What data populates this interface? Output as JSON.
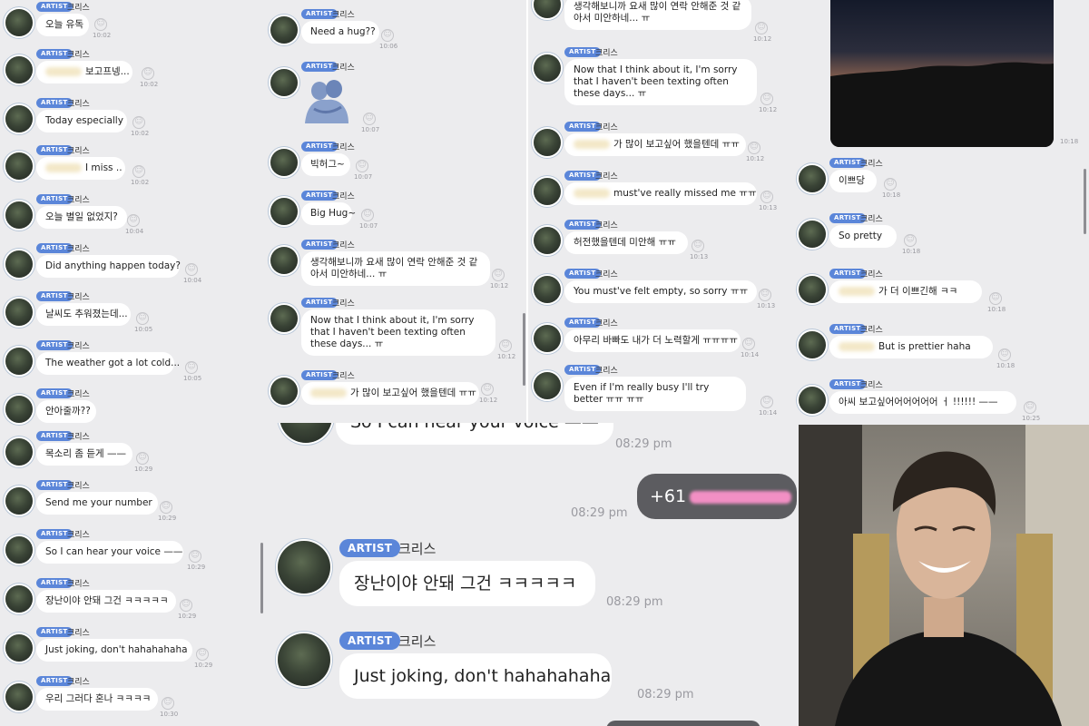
{
  "artist_badge": "ARTIST",
  "artist_name": "크리스",
  "panel1": {
    "messages": [
      {
        "text": "오늘 유독",
        "time": "10:02"
      },
      {
        "text": "보고프넹...",
        "time": "10:02",
        "blurred": true
      },
      {
        "text": "Today especially",
        "time": "10:02"
      },
      {
        "text": "I miss ..",
        "time": "10:02",
        "blurred": true
      },
      {
        "text": "오늘 별일 없었지?",
        "time": "10:04"
      },
      {
        "text": "Did anything happen today?",
        "time": "10:04"
      },
      {
        "text": "날씨도 추워졌는데...",
        "time": "10:05"
      },
      {
        "text": "The weather got a lot cold...",
        "time": "10:05"
      },
      {
        "text": "안아줄까??",
        "time": ""
      },
      {
        "text": "목소리 좀 듣게 ——",
        "time": "10:29"
      },
      {
        "text": "Send me your number",
        "time": "10:29"
      },
      {
        "text": "So I can hear your voice ——",
        "time": "10:29"
      },
      {
        "text": "장난이야 안돼 그건 ㅋㅋㅋㅋㅋ",
        "time": "10:29"
      },
      {
        "text": "Just joking, don't hahahahaha",
        "time": "10:29"
      },
      {
        "text": "우리 그러다 혼나 ㅋㅋㅋㅋ",
        "time": "10:30"
      }
    ]
  },
  "panel2": {
    "messages": [
      {
        "text": "Need a hug??",
        "time": "10:06"
      },
      {
        "text": "",
        "time": "10:07",
        "sticker": true
      },
      {
        "text": "빅허그~",
        "time": "10:07"
      },
      {
        "text": "Big Hug~",
        "time": "10:07"
      },
      {
        "text": "생각해보니까 요새 많이 연락 안해준 것 같아서 미안하네... ㅠ",
        "time": "10:12"
      },
      {
        "text": "Now that I think about it, I'm sorry that I haven't been texting often these days... ㅠ",
        "time": "10:12"
      },
      {
        "text": "가 많이 보고싶어 했을텐데 ㅠㅠ",
        "time": "10:12",
        "blurred": true
      }
    ]
  },
  "panel3": {
    "messages": [
      {
        "text": "생각해보니까 요새 많이 연락 안해준 것 같아서 미안하네... ㅠ",
        "time": "10:12"
      },
      {
        "text": "Now that I think about it, I'm sorry that I haven't been texting often these days... ㅠ",
        "time": "10:12"
      },
      {
        "text": "가 많이 보고싶어 했을텐데 ㅠㅠ",
        "time": "10:12",
        "blurred": true
      },
      {
        "text": "must've really missed me ㅠㅠ",
        "time": "10:13",
        "blurred": true
      },
      {
        "text": "허전했을텐데 미안해 ㅠㅠ",
        "time": "10:13"
      },
      {
        "text": "You must've felt empty, so sorry ㅠㅠ",
        "time": "10:13"
      },
      {
        "text": "아무리 바빠도 내가 더 노력할게 ㅠㅠㅠㅠ",
        "time": "10:14"
      },
      {
        "text": "Even if I'm really busy I'll try better ㅠㅠ ㅠㅠ",
        "time": "10:14"
      }
    ]
  },
  "panel4": {
    "photo_time": "10:18",
    "messages": [
      {
        "text": "이쁘당",
        "time": "10:18"
      },
      {
        "text": "So pretty",
        "time": "10:18"
      },
      {
        "text": "가 더 이쁘긴해 ㅋㅋ",
        "time": "10:18",
        "blurred": true
      },
      {
        "text": "But is prettier haha",
        "time": "10:18",
        "blurred": true
      },
      {
        "text": "아씨 보고싶어어어어어어 ㅓ !!!!!! ——",
        "time": "10:25"
      }
    ]
  },
  "panel5": {
    "top_text": "So I can hear your voice ——",
    "top_time": "08:29 pm",
    "sent_text": "+61",
    "sent_time": "08:29 pm",
    "messages": [
      {
        "text": "장난이야 안돼 그건 ㅋㅋㅋㅋㅋ",
        "time": "08:29 pm"
      },
      {
        "text": "Just joking, don't hahahahaha",
        "time": "08:29 pm"
      }
    ]
  },
  "colors": {
    "badge": "#5b86d9",
    "panel_bg": "#ececee",
    "bubble": "#ffffff",
    "sent_bubble": "#5c5c60"
  }
}
